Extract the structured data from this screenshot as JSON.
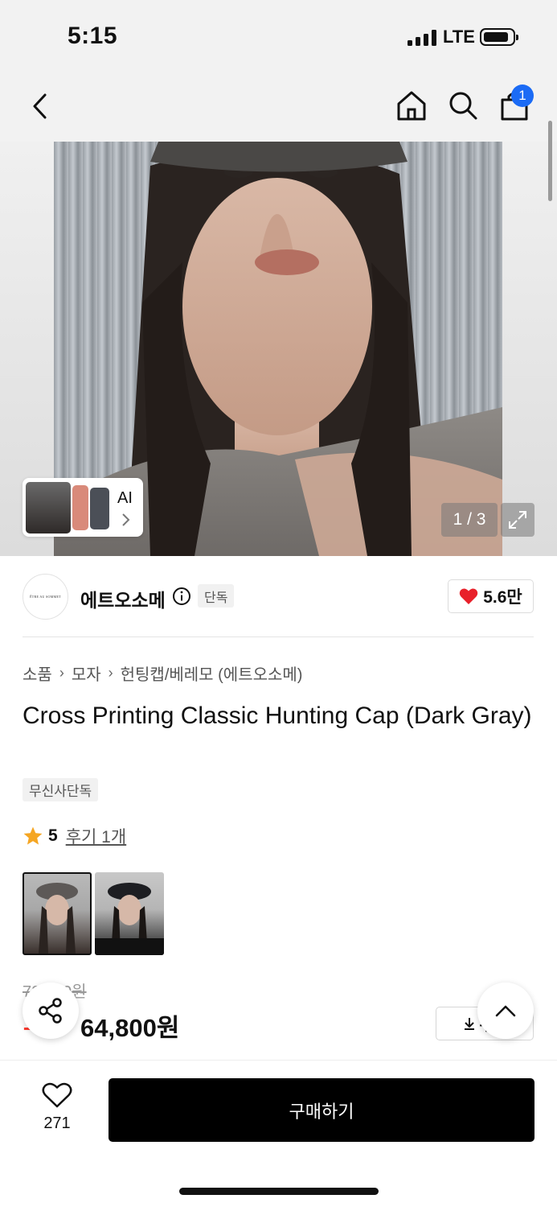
{
  "status_bar": {
    "time": "5:15",
    "network": "LTE"
  },
  "nav": {
    "cart_count": "1"
  },
  "gallery": {
    "page_indicator": "1 / 3",
    "ai_label": "AI"
  },
  "brand": {
    "name": "에트오소메",
    "logo_text": "ÊTRE AU SOMMET",
    "exclusive_tag": "단독",
    "likes": "5.6만"
  },
  "breadcrumb": [
    "소품",
    "모자",
    "헌팅캡/베레모 (에트오소메)"
  ],
  "product": {
    "title": "Cross Printing Classic Hunting Cap (Dark Gray)",
    "tag": "무신사단독",
    "rating": "5",
    "review_link": "후기 1개",
    "color_options": [
      "Dark Gray",
      "Black"
    ]
  },
  "price": {
    "original": "72,000원",
    "discount": "10%",
    "current": "64,800원",
    "coupon_label": "쿠폰"
  },
  "bottom_bar": {
    "wishlist_count": "271",
    "buy_label": "구매하기"
  },
  "colors": {
    "accent_blue": "#1b6bf5",
    "heart_red": "#e8202a",
    "discount_red": "#ff3b30",
    "star": "#f5a623",
    "buy_button": "#000000"
  }
}
